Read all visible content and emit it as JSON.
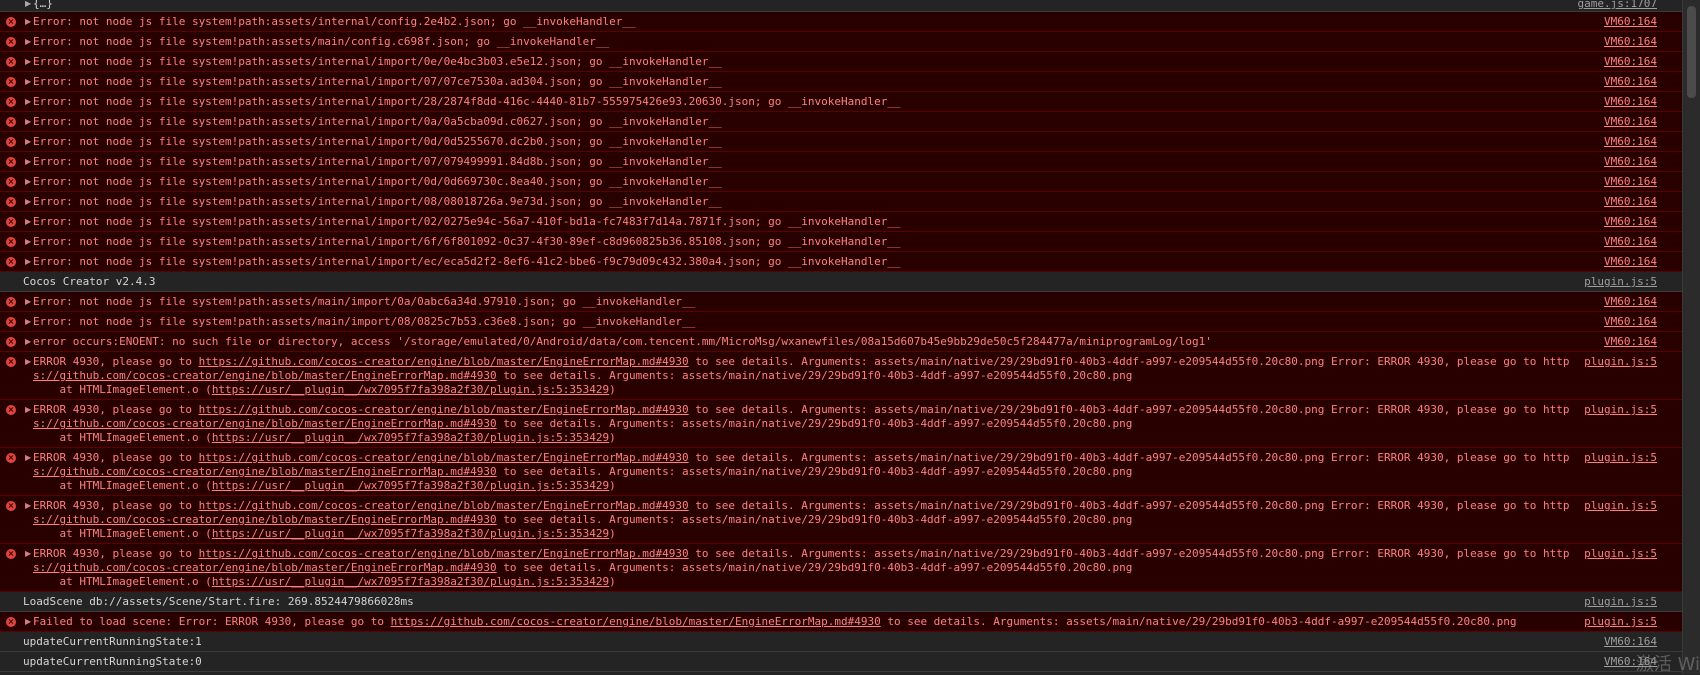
{
  "top_row": {
    "message": "{…}",
    "source": "game.js:1707"
  },
  "rows": [
    {
      "type": "error",
      "message": "Error: not node js file system!path:assets/internal/config.2e4b2.json; go __invokeHandler__",
      "source": "VM60:164"
    },
    {
      "type": "error",
      "message": "Error: not node js file system!path:assets/main/config.c698f.json; go __invokeHandler__",
      "source": "VM60:164"
    },
    {
      "type": "error",
      "message": "Error: not node js file system!path:assets/internal/import/0e/0e4bc3b03.e5e12.json; go __invokeHandler__",
      "source": "VM60:164"
    },
    {
      "type": "error",
      "message": "Error: not node js file system!path:assets/internal/import/07/07ce7530a.ad304.json; go __invokeHandler__",
      "source": "VM60:164"
    },
    {
      "type": "error",
      "message": "Error: not node js file system!path:assets/internal/import/28/2874f8dd-416c-4440-81b7-555975426e93.20630.json; go __invokeHandler__",
      "source": "VM60:164"
    },
    {
      "type": "error",
      "message": "Error: not node js file system!path:assets/internal/import/0a/0a5cba09d.c0627.json; go __invokeHandler__",
      "source": "VM60:164"
    },
    {
      "type": "error",
      "message": "Error: not node js file system!path:assets/internal/import/0d/0d5255670.dc2b0.json; go __invokeHandler__",
      "source": "VM60:164"
    },
    {
      "type": "error",
      "message": "Error: not node js file system!path:assets/internal/import/07/079499991.84d8b.json; go __invokeHandler__",
      "source": "VM60:164"
    },
    {
      "type": "error",
      "message": "Error: not node js file system!path:assets/internal/import/0d/0d669730c.8ea40.json; go __invokeHandler__",
      "source": "VM60:164"
    },
    {
      "type": "error",
      "message": "Error: not node js file system!path:assets/internal/import/08/08018726a.9e73d.json; go __invokeHandler__",
      "source": "VM60:164"
    },
    {
      "type": "error",
      "message": "Error: not node js file system!path:assets/internal/import/02/0275e94c-56a7-410f-bd1a-fc7483f7d14a.7871f.json; go __invokeHandler__",
      "source": "VM60:164"
    },
    {
      "type": "error",
      "message": "Error: not node js file system!path:assets/internal/import/6f/6f801092-0c37-4f30-89ef-c8d960825b36.85108.json; go __invokeHandler__",
      "source": "VM60:164"
    },
    {
      "type": "error",
      "message": "Error: not node js file system!path:assets/internal/import/ec/eca5d2f2-8ef6-41c2-bbe6-f9c79d09c432.380a4.json; go __invokeHandler__",
      "source": "VM60:164"
    },
    {
      "type": "log",
      "message": "Cocos Creator v2.4.3",
      "source": "plugin.js:5"
    },
    {
      "type": "error",
      "message": "Error: not node js file system!path:assets/main/import/0a/0abc6a34d.97910.json; go __invokeHandler__",
      "source": "VM60:164"
    },
    {
      "type": "error",
      "message": "Error: not node js file system!path:assets/main/import/08/0825c7b53.c36e8.json; go __invokeHandler__",
      "source": "VM60:164"
    },
    {
      "type": "error",
      "message": "error occurs:ENOENT: no such file or directory, access '/storage/emulated/0/Android/data/com.tencent.mm/MicroMsg/wxanewfiles/08a15d607b45e9bb29de50c5f284477a/miniprogramLog/log1'",
      "source": "VM60:164"
    }
  ],
  "error4930": {
    "line1_pre": "ERROR 4930, please go to ",
    "link1": "https://github.com/cocos-creator/engine/blob/master/EngineErrorMap.md#4930",
    "line1_post": " to see details. Arguments: assets/main/native/29/29bd91f0-40b3-4ddf-a997-e209544d55f0.20c80.png Error: ERROR 4930, please go to http",
    "line2_link": "s://github.com/cocos-creator/engine/blob/master/EngineErrorMap.md#4930",
    "line2_post": " to see details. Arguments: assets/main/native/29/29bd91f0-40b3-4ddf-a997-e209544d55f0.20c80.png",
    "line3_pre": "    at HTMLImageElement.o (",
    "line3_link": "https://usr/__plugin__/wx7095f7fa398a2f30/plugin.js:5:353429",
    "line3_post": ")",
    "source": "plugin.js:5",
    "count": 5
  },
  "load_scene": {
    "message": "LoadScene db://assets/Scene/Start.fire: 269.8524479866028ms",
    "source": "plugin.js:5"
  },
  "failed_scene": {
    "pre": "Failed to load scene: Error: ERROR 4930, please go to ",
    "link": "https://github.com/cocos-creator/engine/blob/master/EngineErrorMap.md#4930",
    "post": " to see details. Arguments: assets/main/native/29/29bd91f0-40b3-4ddf-a997-e209544d55f0.20c80.png",
    "source": "plugin.js:5"
  },
  "state_rows": [
    {
      "message": "updateCurrentRunningState:1",
      "source": "VM60:164"
    },
    {
      "message": "updateCurrentRunningState:0",
      "source": "VM60:164"
    }
  ],
  "watermark": "激活 Wi",
  "icons": {
    "error": "error-icon",
    "expand": "expand-triangle-icon"
  },
  "colors": {
    "error_bg": "#290000",
    "error_text": "#ff8080",
    "log_bg": "#242424",
    "error_icon": "#e0453f"
  }
}
